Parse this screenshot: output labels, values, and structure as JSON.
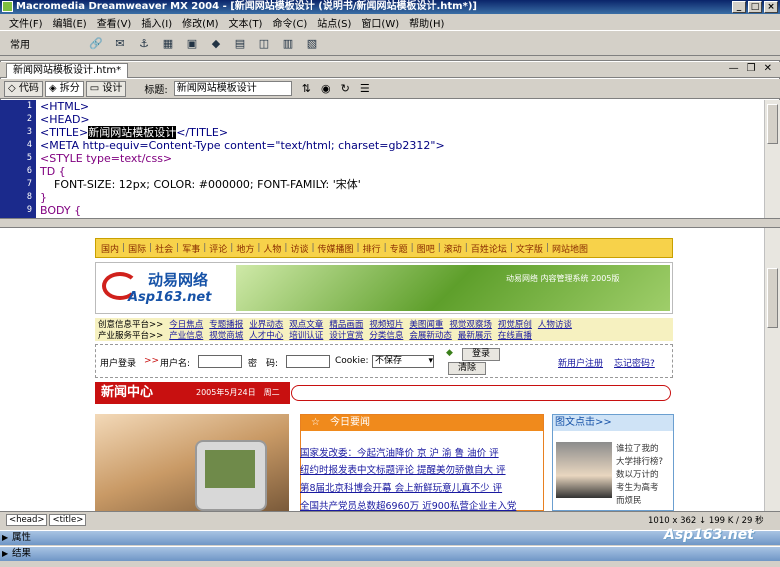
{
  "window": {
    "title": "Macromedia Dreamweaver MX 2004 - [新闻网站模板设计 (说明书/新闻网站模板设计.htm*)]"
  },
  "menu": [
    "文件(F)",
    "编辑(E)",
    "查看(V)",
    "插入(I)",
    "修改(M)",
    "文本(T)",
    "命令(C)",
    "站点(S)",
    "窗口(W)",
    "帮助(H)"
  ],
  "toolbar": {
    "category": "常用"
  },
  "document": {
    "tab": "新闻网站模板设计.htm*",
    "view_code": "代码",
    "view_split": "拆分",
    "view_design": "设计",
    "title_label": "标题:",
    "title_value": "新闻网站模板设计"
  },
  "code": {
    "line_numbers": [
      "1",
      "2",
      "3",
      "4",
      "5",
      "6",
      "7",
      "8",
      "9"
    ],
    "lines": [
      "<HTML>",
      "<HEAD>",
      "<TITLE>",
      "<META http-equiv=Content-Type content=\"text/html; charset=gb2312\">",
      "<STYLE type=text/css>",
      "TD {",
      "    FONT-SIZE: 12px; COLOR: #000000; FONT-FAMILY: '宋体'",
      "}",
      "BODY {"
    ],
    "selected_text": "新闻网站模板设计",
    "after_selected": "</TITLE>"
  },
  "site": {
    "nav": [
      "国内",
      "国际",
      "社会",
      "军事",
      "评论",
      "地方",
      "人物",
      "访谈",
      "传媒播图",
      "排行",
      "专题",
      "图吧",
      "滚动",
      "百姓论坛",
      "文字版",
      "网站地图"
    ],
    "logo_cn": "动易网络",
    "logo_en": "Asp163.net",
    "banner_text": "动易网络 内容管理系统 2005版",
    "cat_row1": [
      "创意信息平台>>",
      "今日焦点",
      "专题播报",
      "业界动态",
      "观点文章",
      "精品画面",
      "视频短片",
      "美图闻重",
      "视觉观察场",
      "视觉原创",
      "人物访谈"
    ],
    "cat_row2": [
      "产业服务平台>>",
      "产业信息",
      "视觉商城",
      "人才中心",
      "培训认证",
      "设计宣赏",
      "分类信息",
      "会展新动态",
      "最新展示",
      "在线直播"
    ],
    "login": {
      "label": "用户登录",
      "arrows": ">>",
      "username": "用户名:",
      "password": "密　码:",
      "cookie": "Cookie:",
      "cookie_option": "不保存",
      "login_btn": "登录",
      "clear_btn": "清除",
      "register": "新用户注册",
      "forgot": "忘记密码?"
    },
    "news_center": "新闻中心",
    "date": "2005年5月24日　周二",
    "today_head": "☆　今日要闻",
    "news": [
      "国家发改委：今起汽油降价 京 沪 渝 鲁 油价 评",
      "纽约时报发表中文标题评论 提醒美勿骄傲自大 评",
      "第8届北京科博会开幕 会上新鲜玩意儿真不少 评",
      "全国共产党员总数超6960万 近900私营企业主入党"
    ],
    "pic_head": "图文点击>>",
    "pic_text": [
      "谁拉了我的",
      "大学排行榜?",
      "数以万计的",
      "考生为高考",
      "而烦民"
    ]
  },
  "status": {
    "tags": [
      "<head>",
      "<title>"
    ],
    "stats": "1010 x 362 ↓ 199 K / 29 秒"
  },
  "watermark": "Asp163.net",
  "panels": [
    "属性",
    "结果"
  ]
}
